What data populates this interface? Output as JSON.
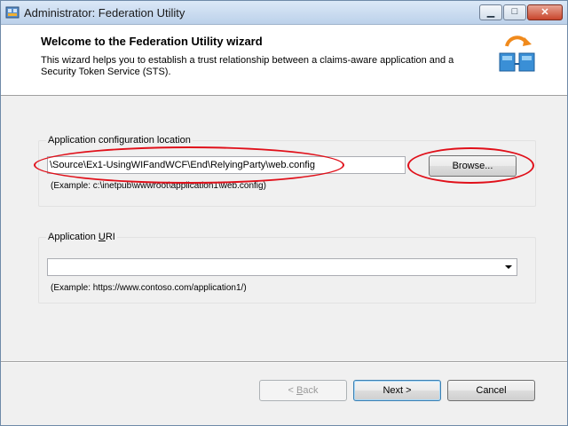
{
  "window": {
    "title": "Administrator: Federation Utility",
    "controls": {
      "minimize": "▁",
      "maximize": "□",
      "close": "✕"
    }
  },
  "header": {
    "title": "Welcome to the Federation Utility wizard",
    "description": "This wizard helps you to establish a trust relationship between a claims-aware application and a Security Token Service (STS).",
    "icon": "federation-sync-icon"
  },
  "config_group": {
    "label": "Application configuration location",
    "value": "\\Source\\Ex1-UsingWIFandWCF\\End\\RelyingParty\\web.config",
    "browse_label": "Browse...",
    "example": "(Example: c:\\inetpub\\wwwroot\\application1\\web.config)"
  },
  "uri_group": {
    "label_prefix": "Application ",
    "label_accel": "U",
    "label_suffix": "RI",
    "value": "",
    "example": "(Example: https://www.contoso.com/application1/)"
  },
  "footer": {
    "back_prefix": "< ",
    "back_accel": "B",
    "back_suffix": "ack",
    "next_label": "Next >",
    "cancel_label": "Cancel"
  },
  "colors": {
    "highlight_ellipse": "#e0101a",
    "default_button_border": "#3c7fb1"
  }
}
